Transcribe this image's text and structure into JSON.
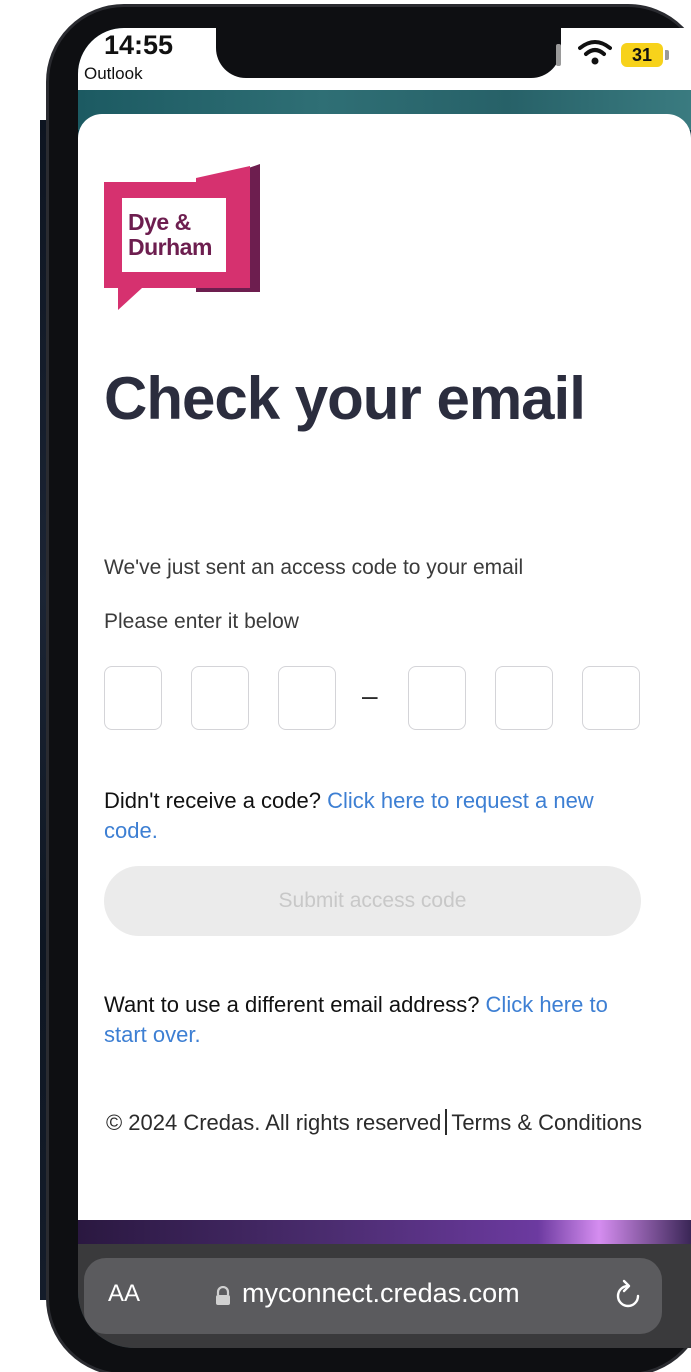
{
  "status_bar": {
    "time": "14:55",
    "back_app": "Outlook",
    "battery": "31"
  },
  "logo": {
    "line1": "Dye &",
    "line2": "Durham"
  },
  "main": {
    "title": "Check your email",
    "sent_text": "We've just sent an access code to your email",
    "enter_text": "Please enter it below",
    "code_placeholder": "",
    "code_separator": "–",
    "resend_prefix": "Didn't receive a code? ",
    "resend_link": "Click here to request a new code.",
    "submit_label": "Submit access code",
    "start_over_prefix": "Want to use a different email address? ",
    "start_over_link": "Click here to start over."
  },
  "footer": {
    "copyright": "© 2024 Credas. All rights reserved",
    "terms_link": "Terms & Conditions"
  },
  "browser": {
    "text_size_label": "AA",
    "url": "myconnect.credas.com"
  },
  "colors": {
    "logo_pink": "#d6316f",
    "logo_purple": "#6d1e4f",
    "title": "#2b2d3e",
    "link": "#3d7fd3",
    "button_disabled_bg": "#ebebeb"
  }
}
